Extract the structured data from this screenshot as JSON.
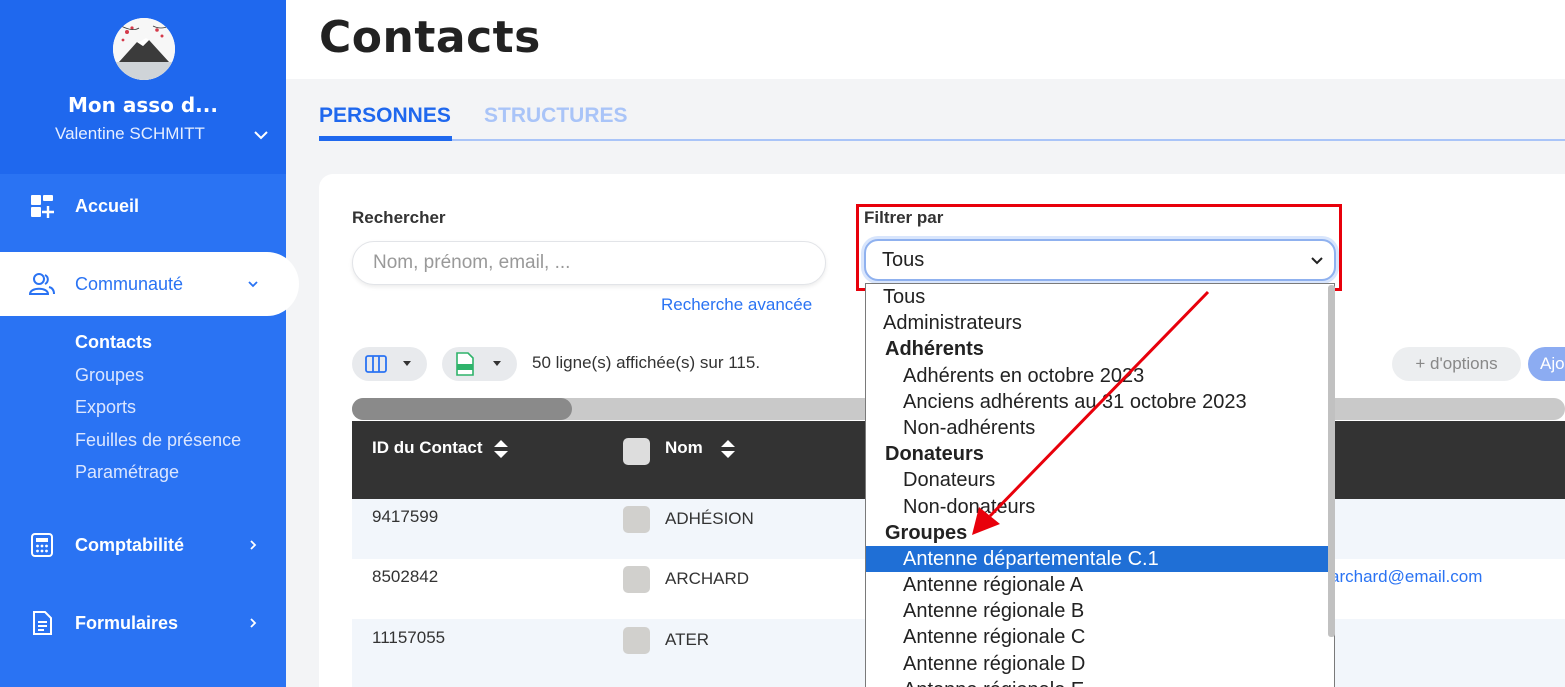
{
  "sidebar": {
    "org_name": "Mon asso d...",
    "user_name": "Valentine SCHMITT",
    "nav": [
      {
        "label": "Accueil",
        "icon": "dashboard-icon"
      },
      {
        "label": "Communauté",
        "icon": "users-icon"
      },
      {
        "label": "Comptabilité",
        "icon": "calculator-icon"
      },
      {
        "label": "Formulaires",
        "icon": "document-icon"
      }
    ],
    "sub_items": [
      "Contacts",
      "Groupes",
      "Exports",
      "Feuilles de présence",
      "Paramétrage"
    ]
  },
  "main": {
    "title": "Contacts",
    "tabs": [
      {
        "label": "PERSONNES",
        "active": true
      },
      {
        "label": "STRUCTURES",
        "active": false
      }
    ],
    "search": {
      "label": "Rechercher",
      "placeholder": "Nom, prénom, email, ...",
      "advanced": "Recherche avancée"
    },
    "filter": {
      "label": "Filtrer par",
      "selected": "Tous"
    },
    "rows_info": "50 ligne(s) affichée(s) sur 115.",
    "more_options": "+ d'options",
    "add_label": "Ajo"
  },
  "table": {
    "headers": [
      "ID du Contact",
      "Nom"
    ],
    "rows": [
      {
        "id": "9417599",
        "nom": "ADHÉSION"
      },
      {
        "id": "8502842",
        "nom": "ARCHARD",
        "email": "archard@email.com"
      },
      {
        "id": "11157055",
        "nom": "ATER"
      }
    ]
  },
  "dropdown": {
    "options": [
      {
        "label": "Tous",
        "kind": "option"
      },
      {
        "label": "Administrateurs",
        "kind": "option"
      },
      {
        "label": "Adhérents",
        "kind": "group"
      },
      {
        "label": "Adhérents en octobre 2023",
        "kind": "child"
      },
      {
        "label": "Anciens adhérents au 31 octobre 2023",
        "kind": "child"
      },
      {
        "label": "Non-adhérents",
        "kind": "child"
      },
      {
        "label": "Donateurs",
        "kind": "group"
      },
      {
        "label": "Donateurs",
        "kind": "child"
      },
      {
        "label": "Non-donateurs",
        "kind": "child"
      },
      {
        "label": "Groupes",
        "kind": "group"
      },
      {
        "label": "Antenne départementale C.1",
        "kind": "child",
        "selected": true
      },
      {
        "label": "Antenne régionale A",
        "kind": "child"
      },
      {
        "label": "Antenne régionale B",
        "kind": "child"
      },
      {
        "label": "Antenne régionale C",
        "kind": "child"
      },
      {
        "label": "Antenne régionale D",
        "kind": "child"
      },
      {
        "label": "Antenne régionale E",
        "kind": "child"
      }
    ]
  },
  "colors": {
    "primary": "#2a73f3",
    "highlight": "#e8000b",
    "selected": "#1f6fd6"
  }
}
